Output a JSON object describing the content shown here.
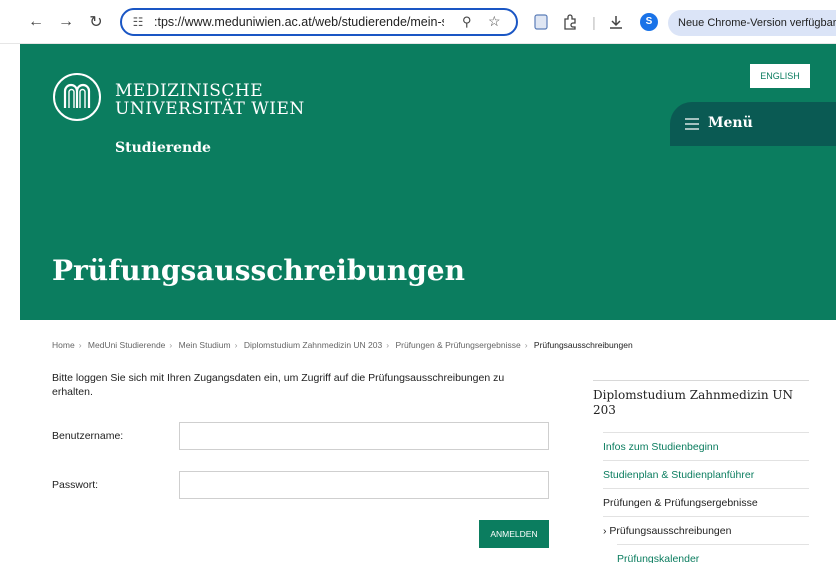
{
  "browser": {
    "url": ":tps://www.meduniwien.ac.at/web/studierende/mein-stu",
    "update_text": "Neue Chrome-Version verfügbar",
    "avatar_letter": "S"
  },
  "header": {
    "logo_line1": "MEDIZINISCHE",
    "logo_line2": "UNIVERSITÄT WIEN",
    "subtitle": "Studierende",
    "english_label": "ENGLISH",
    "menu_label": "Menü",
    "page_title": "Prüfungsausschreibungen",
    "brand_color": "#0b7d5f"
  },
  "breadcrumb": {
    "items": [
      "Home",
      "MedUni Studierende",
      "Mein Studium",
      "Diplomstudium Zahnmedizin UN 203",
      "Prüfungen & Prüfungsergebnisse"
    ],
    "current": "Prüfungsausschreibungen"
  },
  "login": {
    "intro": "Bitte loggen Sie sich mit Ihren Zugangsdaten ein, um Zugriff auf die Prüfungsausschreibungen zu erhalten.",
    "username_label": "Benutzername:",
    "password_label": "Passwort:",
    "username_value": "",
    "password_value": "",
    "submit_label": "ANMELDEN"
  },
  "sidebar": {
    "title": "Diplomstudium Zahnmedizin UN 203",
    "items": [
      {
        "label": "Infos zum Studienbeginn"
      },
      {
        "label": "Studienplan & Studienplanführer"
      },
      {
        "label": "Prüfungen & Prüfungsergebnisse"
      },
      {
        "label": "Prüfungsausschreibungen"
      },
      {
        "label": "Prüfungskalender"
      }
    ],
    "active_marker": "›"
  }
}
